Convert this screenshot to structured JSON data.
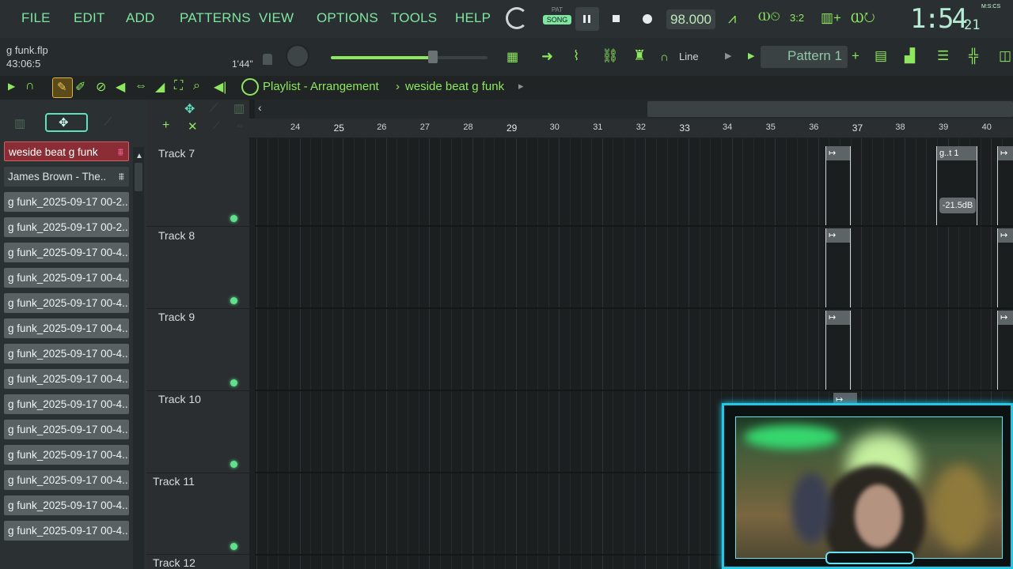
{
  "menu": [
    "FILE",
    "EDIT",
    "ADD",
    "PATTERNS",
    "VIEW",
    "OPTIONS",
    "TOOLS",
    "HELP"
  ],
  "transport": {
    "pat_label": "PAT",
    "song_label": "SONG",
    "tempo": "98.000",
    "time_big": "1:54",
    "time_small": "21",
    "time_mode": "M:S:CS",
    "ratio": "3:2"
  },
  "project": {
    "file": "g funk.flp",
    "time": "43:06:5",
    "hint": "1'44\""
  },
  "snap": {
    "label": "Line"
  },
  "pattern": {
    "label": "Pattern 1"
  },
  "playlist": {
    "title": "Playlist - Arrangement",
    "arrangement": "weside beat g funk"
  },
  "browser": {
    "items": [
      "weside beat g funk",
      "James Brown - The..",
      "g funk_2025-09-17 00-2..",
      "g funk_2025-09-17 00-2..",
      "g funk_2025-09-17 00-4..",
      "g funk_2025-09-17 00-4..",
      "g funk_2025-09-17 00-4..",
      "g funk_2025-09-17 00-4..",
      "g funk_2025-09-17 00-4..",
      "g funk_2025-09-17 00-4..",
      "g funk_2025-09-17 00-4..",
      "g funk_2025-09-17 00-4..",
      "g funk_2025-09-17 00-4..",
      "g funk_2025-09-17 00-4..",
      "g funk_2025-09-17 00-4..",
      "g funk_2025-09-17 00-4.."
    ]
  },
  "tracks": [
    "Track 7",
    "Track 8",
    "Track 9",
    "Track 10",
    "Track 11",
    "Track 12"
  ],
  "ruler": [
    "24",
    "25",
    "26",
    "27",
    "28",
    "29",
    "30",
    "31",
    "32",
    "33",
    "34",
    "35",
    "36",
    "37",
    "38",
    "39",
    "40"
  ],
  "clips": {
    "label": "g..t 1",
    "volume": "-21.5dB"
  },
  "colors": {
    "accent": "#8de860",
    "menu_text": "#7fe6a2",
    "selected": "#8a2d34",
    "cam_border": "#22c9e6"
  }
}
